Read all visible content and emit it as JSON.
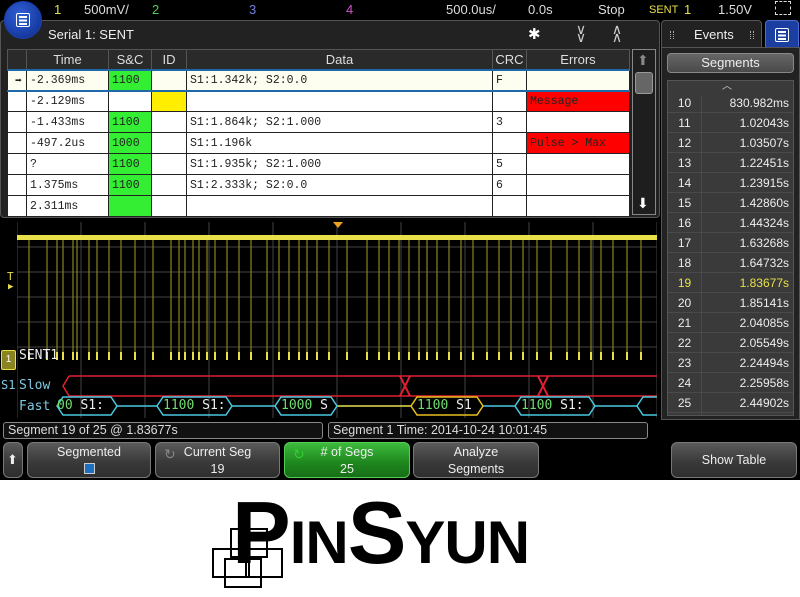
{
  "topbar": {
    "ch1_label": "1",
    "ch1_scale": "500mV/",
    "ch2_label": "2",
    "ch3_label": "3",
    "ch4_label": "4",
    "timebase": "500.0us/",
    "delay": "0.0s",
    "run_state": "Stop",
    "trigger_type": "SENT",
    "trigger_source": "1",
    "trigger_level": "1.50V",
    "colors": {
      "ch1": "#e8e04a",
      "ch2": "#55cc55",
      "ch3": "#6f7fdc",
      "ch4": "#d050d0"
    }
  },
  "serial_panel": {
    "title": "Serial 1: SENT",
    "columns": [
      "",
      "Time",
      "S&C",
      "ID",
      "Data",
      "CRC",
      "Errors"
    ],
    "rows": [
      {
        "marker": "➡",
        "time": "-2.369ms",
        "sc": "1100",
        "id": "",
        "data": "S1:1.342k; S2:0.0",
        "crc": "F",
        "errors": "",
        "selected": true
      },
      {
        "marker": "",
        "time": "-2.129ms",
        "sc": "",
        "id": "",
        "data": "",
        "crc": "",
        "errors": "Message"
      },
      {
        "marker": "",
        "time": "-1.433ms",
        "sc": "1100",
        "id": "",
        "data": "S1:1.864k; S2:1.000",
        "crc": "3",
        "errors": ""
      },
      {
        "marker": "",
        "time": "-497.2us",
        "sc": "1000",
        "id": "",
        "data": "S1:1.196k",
        "crc": "",
        "errors": "Pulse > Max"
      },
      {
        "marker": "",
        "time": "?",
        "sc": "1100",
        "id": "",
        "data": "S1:1.935k; S2:1.000",
        "crc": "5",
        "errors": ""
      },
      {
        "marker": "",
        "time": "1.375ms",
        "sc": "1100",
        "id": "",
        "data": "S1:2.333k; S2:0.0",
        "crc": "6",
        "errors": ""
      },
      {
        "marker": "",
        "time": "2.311ms",
        "sc": "",
        "id": "",
        "data": "",
        "crc": "",
        "errors": ""
      }
    ]
  },
  "waveform": {
    "channel_label": "SENT1",
    "trigger_marker": "T",
    "serial_label": "S1",
    "slow_label": "Slow",
    "fast_label": "Fast",
    "fast_packets": [
      {
        "sc": "00",
        "text": "S1:"
      },
      {
        "sc": "1100",
        "text": "S1:"
      },
      {
        "sc": "1000",
        "text": "S"
      },
      {
        "sc": "1100",
        "text": "S1"
      },
      {
        "sc": "1100",
        "text": "S1:"
      }
    ]
  },
  "events_panel": {
    "title": "Events",
    "segments_button": "Segments",
    "segments": [
      {
        "index": "10",
        "time": "830.982ms"
      },
      {
        "index": "11",
        "time": "1.02043s"
      },
      {
        "index": "12",
        "time": "1.03507s"
      },
      {
        "index": "13",
        "time": "1.22451s"
      },
      {
        "index": "14",
        "time": "1.23915s"
      },
      {
        "index": "15",
        "time": "1.42860s"
      },
      {
        "index": "16",
        "time": "1.44324s"
      },
      {
        "index": "17",
        "time": "1.63268s"
      },
      {
        "index": "18",
        "time": "1.64732s"
      },
      {
        "index": "19",
        "time": "1.83677s",
        "active": true
      },
      {
        "index": "20",
        "time": "1.85141s"
      },
      {
        "index": "21",
        "time": "2.04085s"
      },
      {
        "index": "22",
        "time": "2.05549s"
      },
      {
        "index": "23",
        "time": "2.24494s"
      },
      {
        "index": "24",
        "time": "2.25958s"
      },
      {
        "index": "25",
        "time": "2.44902s"
      }
    ]
  },
  "status": {
    "segment_info": "Segment 19 of 25 @ 1.83677s",
    "segment_time": "Segment 1 Time: 2014-10-24 10:01:45"
  },
  "softkeys": {
    "segmented_label": "Segmented",
    "segmented_checked": true,
    "current_seg_label": "Current Seg",
    "current_seg_value": "19",
    "num_segs_label": "# of Segs",
    "num_segs_value": "25",
    "analyze_line1": "Analyze",
    "analyze_line2": "Segments",
    "show_table_label": "Show Table"
  },
  "logo": {
    "text_p": "P",
    "text_in": "IN",
    "text_s": "S",
    "text_yun": "YUN"
  }
}
